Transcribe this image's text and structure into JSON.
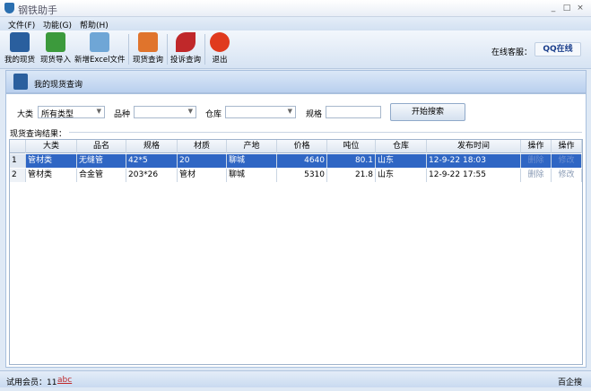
{
  "window": {
    "title": "钢铁助手",
    "controls": [
      "_",
      "□",
      "×"
    ]
  },
  "menu": [
    "文件(F)",
    "功能(G)",
    "帮助(H)"
  ],
  "toolbar": {
    "items": [
      {
        "label": "我的现货",
        "icon": "stock-icon",
        "color": "#2a5f9e"
      },
      {
        "label": "现货导入",
        "icon": "excel-icon",
        "color": "#3c9a3c"
      },
      {
        "label": "新增Excel文件",
        "icon": "add-folder-icon",
        "color": "#6fa6d6"
      },
      {
        "label": "现货查询",
        "icon": "search-folder-icon",
        "color": "#e0742c"
      },
      {
        "label": "投诉查询",
        "icon": "phone-icon",
        "color": "#c0282a"
      },
      {
        "label": "退出",
        "icon": "power-icon",
        "color": "#e03a1e"
      }
    ],
    "online_label": "在线客服：",
    "qq_label": "QQ在线"
  },
  "panel": {
    "title": "我的现货查询"
  },
  "filters": {
    "category_label": "大类",
    "category_value": "所有类型",
    "variety_label": "品种",
    "variety_value": "",
    "warehouse_label": "仓库",
    "warehouse_value": "",
    "spec_label": "规格",
    "spec_value": "",
    "search_button": "开始搜索"
  },
  "results": {
    "label": "现货查询结果：",
    "columns": [
      "大类",
      "品名",
      "规格",
      "材质",
      "产地",
      "价格",
      "吨位",
      "仓库",
      "发布时间",
      "操作",
      "操作"
    ],
    "rows": [
      {
        "num": "1",
        "cells": [
          "管材类",
          "无缝管",
          "42*5",
          "20",
          "聊城",
          "4640",
          "80.1",
          "山东",
          "12-9-22 18:03"
        ],
        "delete": "删除",
        "edit": "修改",
        "selected": true
      },
      {
        "num": "2",
        "cells": [
          "管材类",
          "合金管",
          "203*26",
          "管材",
          "聊城",
          "5310",
          "21.8",
          "山东",
          "12-9-22 17:55"
        ],
        "delete": "删除",
        "edit": "修改",
        "selected": false
      }
    ]
  },
  "status": {
    "member": "试用会员：11",
    "link": "abc",
    "right": "百企搜"
  }
}
